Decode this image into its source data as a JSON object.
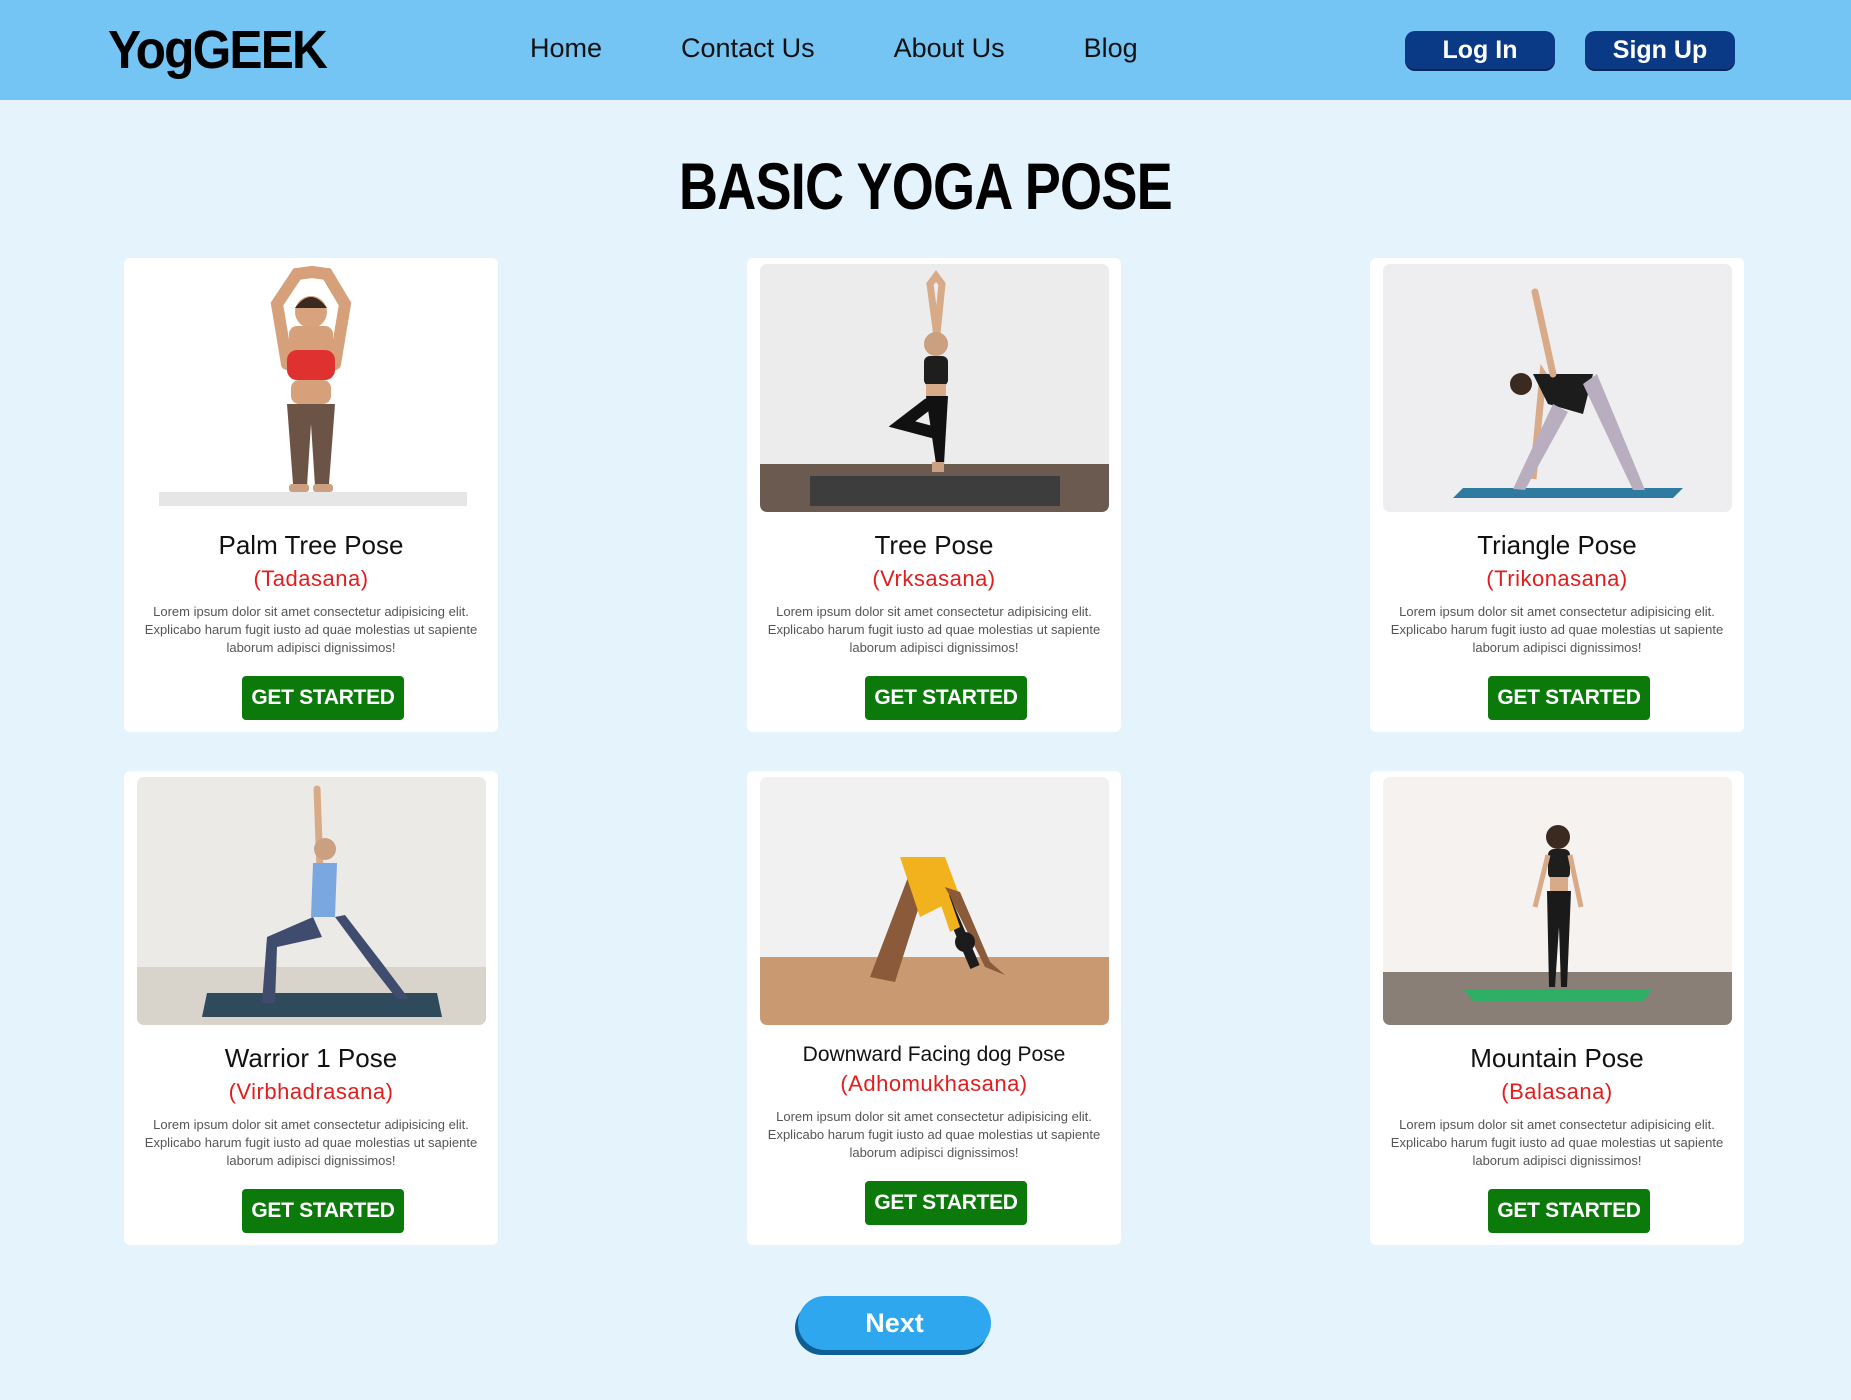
{
  "header": {
    "logo": "YogGEEK",
    "nav": [
      "Home",
      "Contact Us",
      "About Us",
      "Blog"
    ],
    "login_label": "Log In",
    "signup_label": "Sign Up"
  },
  "page": {
    "title": "BASIC YOGA POSE"
  },
  "cards": [
    {
      "name": "Palm Tree Pose",
      "sanskrit": "(Tadasana)",
      "desc": "Lorem ipsum dolor sit amet consectetur adipisicing elit. Explicabo harum fugit iusto ad quae molestias ut sapiente laborum adipisci dignissimos!",
      "cta": "GET STARTED"
    },
    {
      "name": "Tree Pose",
      "sanskrit": "(Vrksasana)",
      "desc": "Lorem ipsum dolor sit amet consectetur adipisicing elit. Explicabo harum fugit iusto ad quae molestias ut sapiente laborum adipisci dignissimos!",
      "cta": "GET STARTED"
    },
    {
      "name": "Triangle Pose",
      "sanskrit": "(Trikonasana)",
      "desc": "Lorem ipsum dolor sit amet consectetur adipisicing elit. Explicabo harum fugit iusto ad quae molestias ut sapiente laborum adipisci dignissimos!",
      "cta": "GET STARTED"
    },
    {
      "name": "Warrior 1 Pose",
      "sanskrit": "(Virbhadrasana)",
      "desc": "Lorem ipsum dolor sit amet consectetur adipisicing elit. Explicabo harum fugit iusto ad quae molestias ut sapiente laborum adipisci dignissimos!",
      "cta": "GET STARTED"
    },
    {
      "name": "Downward Facing dog Pose",
      "sanskrit": "(Adhomukhasana)",
      "desc": "Lorem ipsum dolor sit amet consectetur adipisicing elit. Explicabo harum fugit iusto ad quae molestias ut sapiente laborum adipisci dignissimos!",
      "cta": "GET STARTED"
    },
    {
      "name": "Mountain Pose",
      "sanskrit": "(Balasana)",
      "desc": "Lorem ipsum dolor sit amet consectetur adipisicing elit. Explicabo harum fugit iusto ad quae molestias ut sapiente laborum adipisci dignissimos!",
      "cta": "GET STARTED"
    }
  ],
  "next_label": "Next",
  "colors": {
    "header_bg": "#74c4f4",
    "page_bg": "#e4f3fc",
    "auth_button": "#0a3a86",
    "cta_button": "#0b7a0b",
    "sanskrit_text": "#e31d1d",
    "next_button": "#2ea7ee"
  }
}
